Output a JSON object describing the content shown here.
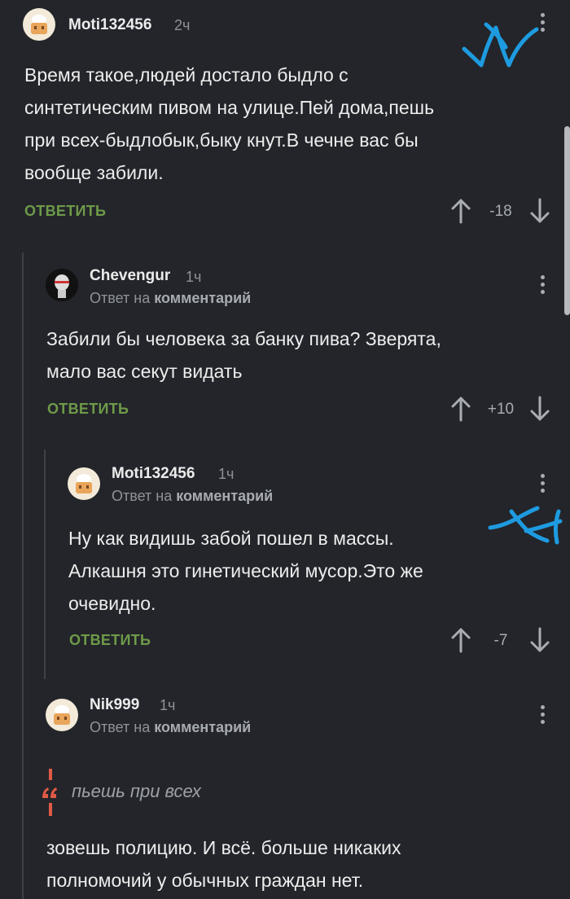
{
  "comments": [
    {
      "username": "Moti132456",
      "time": "2ч",
      "text": [
        "Время такое,людей достало быдло с",
        "синтетическим пивом на улице.Пей дома,пешь",
        "при всех-быдлобык,быку кнут.В чечне вас бы",
        "вообще забили."
      ],
      "reply_label": "ОТВЕТИТЬ",
      "score": "-18"
    },
    {
      "username": "Chevengur",
      "time": "1ч",
      "reply_prefix": "Ответ на",
      "reply_link": "комментарий",
      "text": [
        "Забили бы человека за банку пива? Зверята,",
        "мало вас секут видать"
      ],
      "reply_label": "ОТВЕТИТЬ",
      "score": "+10"
    },
    {
      "username": "Moti132456",
      "time": "1ч",
      "reply_prefix": "Ответ на",
      "reply_link": "комментарий",
      "text": [
        "Ну как видишь забой пошел в массы.",
        "Алкашня это гинетический мусор.Это же",
        "очевидно."
      ],
      "reply_label": "ОТВЕТИТЬ",
      "score": "-7"
    },
    {
      "username": "Nik999",
      "time": "1ч",
      "reply_prefix": "Ответ на",
      "reply_link": "комментарий",
      "quote": "пьешь при всех",
      "text": [
        "зовешь полицию. И всё. больше никаких",
        "полномочий у обычных граждан нет."
      ]
    }
  ],
  "colors": {
    "background": "#23252a",
    "reply_button": "#6e9a49",
    "quote_accent": "#e05a45",
    "scribble": "#1e9be0"
  },
  "icons": {
    "upvote": "arrow-up-icon",
    "downvote": "arrow-down-icon",
    "menu": "more-vertical-icon",
    "quote": "quote-icon"
  }
}
